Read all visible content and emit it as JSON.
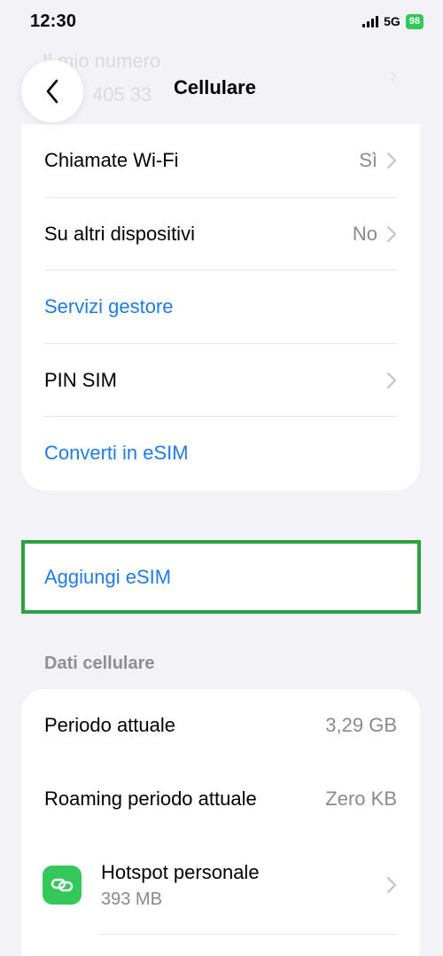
{
  "status_bar": {
    "time": "12:30",
    "network": "5G",
    "battery": "98"
  },
  "ghost": {
    "line1": "Il mio numero",
    "line2": "405 33"
  },
  "nav": {
    "title": "Cellulare"
  },
  "settings": [
    {
      "label": "Chiamate Wi-Fi",
      "value": "Sì"
    },
    {
      "label": "Su altri dispositivi",
      "value": "No"
    },
    {
      "label": "Servizi gestore"
    },
    {
      "label": "PIN SIM"
    },
    {
      "label": "Converti in eSIM"
    }
  ],
  "add_esim": {
    "label": "Aggiungi eSIM"
  },
  "data_section": {
    "header": "Dati cellulare",
    "rows": [
      {
        "label": "Periodo attuale",
        "value": "3,29 GB"
      },
      {
        "label": "Roaming periodo attuale",
        "value": "Zero KB"
      }
    ],
    "hotspot": {
      "label": "Hotspot personale",
      "value": "393 MB"
    }
  },
  "colors": {
    "link": "#1e7ce8",
    "highlight": "#2aa241",
    "hotspot_icon": "#34c759"
  }
}
